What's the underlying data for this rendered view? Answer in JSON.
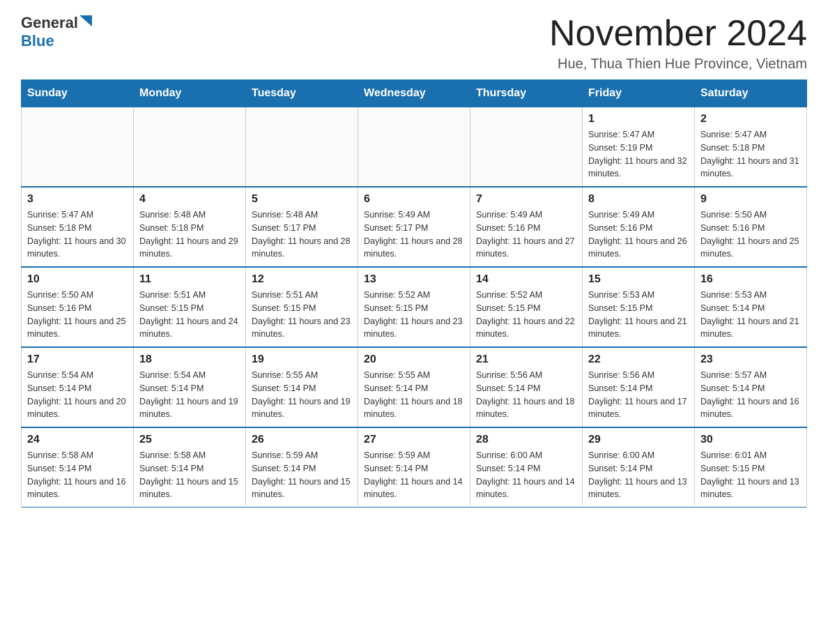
{
  "logo": {
    "general": "General",
    "triangle": "",
    "blue": "Blue"
  },
  "title": "November 2024",
  "location": "Hue, Thua Thien Hue Province, Vietnam",
  "days_of_week": [
    "Sunday",
    "Monday",
    "Tuesday",
    "Wednesday",
    "Thursday",
    "Friday",
    "Saturday"
  ],
  "weeks": [
    [
      {
        "day": "",
        "sunrise": "",
        "sunset": "",
        "daylight": ""
      },
      {
        "day": "",
        "sunrise": "",
        "sunset": "",
        "daylight": ""
      },
      {
        "day": "",
        "sunrise": "",
        "sunset": "",
        "daylight": ""
      },
      {
        "day": "",
        "sunrise": "",
        "sunset": "",
        "daylight": ""
      },
      {
        "day": "",
        "sunrise": "",
        "sunset": "",
        "daylight": ""
      },
      {
        "day": "1",
        "sunrise": "Sunrise: 5:47 AM",
        "sunset": "Sunset: 5:19 PM",
        "daylight": "Daylight: 11 hours and 32 minutes."
      },
      {
        "day": "2",
        "sunrise": "Sunrise: 5:47 AM",
        "sunset": "Sunset: 5:18 PM",
        "daylight": "Daylight: 11 hours and 31 minutes."
      }
    ],
    [
      {
        "day": "3",
        "sunrise": "Sunrise: 5:47 AM",
        "sunset": "Sunset: 5:18 PM",
        "daylight": "Daylight: 11 hours and 30 minutes."
      },
      {
        "day": "4",
        "sunrise": "Sunrise: 5:48 AM",
        "sunset": "Sunset: 5:18 PM",
        "daylight": "Daylight: 11 hours and 29 minutes."
      },
      {
        "day": "5",
        "sunrise": "Sunrise: 5:48 AM",
        "sunset": "Sunset: 5:17 PM",
        "daylight": "Daylight: 11 hours and 28 minutes."
      },
      {
        "day": "6",
        "sunrise": "Sunrise: 5:49 AM",
        "sunset": "Sunset: 5:17 PM",
        "daylight": "Daylight: 11 hours and 28 minutes."
      },
      {
        "day": "7",
        "sunrise": "Sunrise: 5:49 AM",
        "sunset": "Sunset: 5:16 PM",
        "daylight": "Daylight: 11 hours and 27 minutes."
      },
      {
        "day": "8",
        "sunrise": "Sunrise: 5:49 AM",
        "sunset": "Sunset: 5:16 PM",
        "daylight": "Daylight: 11 hours and 26 minutes."
      },
      {
        "day": "9",
        "sunrise": "Sunrise: 5:50 AM",
        "sunset": "Sunset: 5:16 PM",
        "daylight": "Daylight: 11 hours and 25 minutes."
      }
    ],
    [
      {
        "day": "10",
        "sunrise": "Sunrise: 5:50 AM",
        "sunset": "Sunset: 5:16 PM",
        "daylight": "Daylight: 11 hours and 25 minutes."
      },
      {
        "day": "11",
        "sunrise": "Sunrise: 5:51 AM",
        "sunset": "Sunset: 5:15 PM",
        "daylight": "Daylight: 11 hours and 24 minutes."
      },
      {
        "day": "12",
        "sunrise": "Sunrise: 5:51 AM",
        "sunset": "Sunset: 5:15 PM",
        "daylight": "Daylight: 11 hours and 23 minutes."
      },
      {
        "day": "13",
        "sunrise": "Sunrise: 5:52 AM",
        "sunset": "Sunset: 5:15 PM",
        "daylight": "Daylight: 11 hours and 23 minutes."
      },
      {
        "day": "14",
        "sunrise": "Sunrise: 5:52 AM",
        "sunset": "Sunset: 5:15 PM",
        "daylight": "Daylight: 11 hours and 22 minutes."
      },
      {
        "day": "15",
        "sunrise": "Sunrise: 5:53 AM",
        "sunset": "Sunset: 5:15 PM",
        "daylight": "Daylight: 11 hours and 21 minutes."
      },
      {
        "day": "16",
        "sunrise": "Sunrise: 5:53 AM",
        "sunset": "Sunset: 5:14 PM",
        "daylight": "Daylight: 11 hours and 21 minutes."
      }
    ],
    [
      {
        "day": "17",
        "sunrise": "Sunrise: 5:54 AM",
        "sunset": "Sunset: 5:14 PM",
        "daylight": "Daylight: 11 hours and 20 minutes."
      },
      {
        "day": "18",
        "sunrise": "Sunrise: 5:54 AM",
        "sunset": "Sunset: 5:14 PM",
        "daylight": "Daylight: 11 hours and 19 minutes."
      },
      {
        "day": "19",
        "sunrise": "Sunrise: 5:55 AM",
        "sunset": "Sunset: 5:14 PM",
        "daylight": "Daylight: 11 hours and 19 minutes."
      },
      {
        "day": "20",
        "sunrise": "Sunrise: 5:55 AM",
        "sunset": "Sunset: 5:14 PM",
        "daylight": "Daylight: 11 hours and 18 minutes."
      },
      {
        "day": "21",
        "sunrise": "Sunrise: 5:56 AM",
        "sunset": "Sunset: 5:14 PM",
        "daylight": "Daylight: 11 hours and 18 minutes."
      },
      {
        "day": "22",
        "sunrise": "Sunrise: 5:56 AM",
        "sunset": "Sunset: 5:14 PM",
        "daylight": "Daylight: 11 hours and 17 minutes."
      },
      {
        "day": "23",
        "sunrise": "Sunrise: 5:57 AM",
        "sunset": "Sunset: 5:14 PM",
        "daylight": "Daylight: 11 hours and 16 minutes."
      }
    ],
    [
      {
        "day": "24",
        "sunrise": "Sunrise: 5:58 AM",
        "sunset": "Sunset: 5:14 PM",
        "daylight": "Daylight: 11 hours and 16 minutes."
      },
      {
        "day": "25",
        "sunrise": "Sunrise: 5:58 AM",
        "sunset": "Sunset: 5:14 PM",
        "daylight": "Daylight: 11 hours and 15 minutes."
      },
      {
        "day": "26",
        "sunrise": "Sunrise: 5:59 AM",
        "sunset": "Sunset: 5:14 PM",
        "daylight": "Daylight: 11 hours and 15 minutes."
      },
      {
        "day": "27",
        "sunrise": "Sunrise: 5:59 AM",
        "sunset": "Sunset: 5:14 PM",
        "daylight": "Daylight: 11 hours and 14 minutes."
      },
      {
        "day": "28",
        "sunrise": "Sunrise: 6:00 AM",
        "sunset": "Sunset: 5:14 PM",
        "daylight": "Daylight: 11 hours and 14 minutes."
      },
      {
        "day": "29",
        "sunrise": "Sunrise: 6:00 AM",
        "sunset": "Sunset: 5:14 PM",
        "daylight": "Daylight: 11 hours and 13 minutes."
      },
      {
        "day": "30",
        "sunrise": "Sunrise: 6:01 AM",
        "sunset": "Sunset: 5:15 PM",
        "daylight": "Daylight: 11 hours and 13 minutes."
      }
    ]
  ]
}
